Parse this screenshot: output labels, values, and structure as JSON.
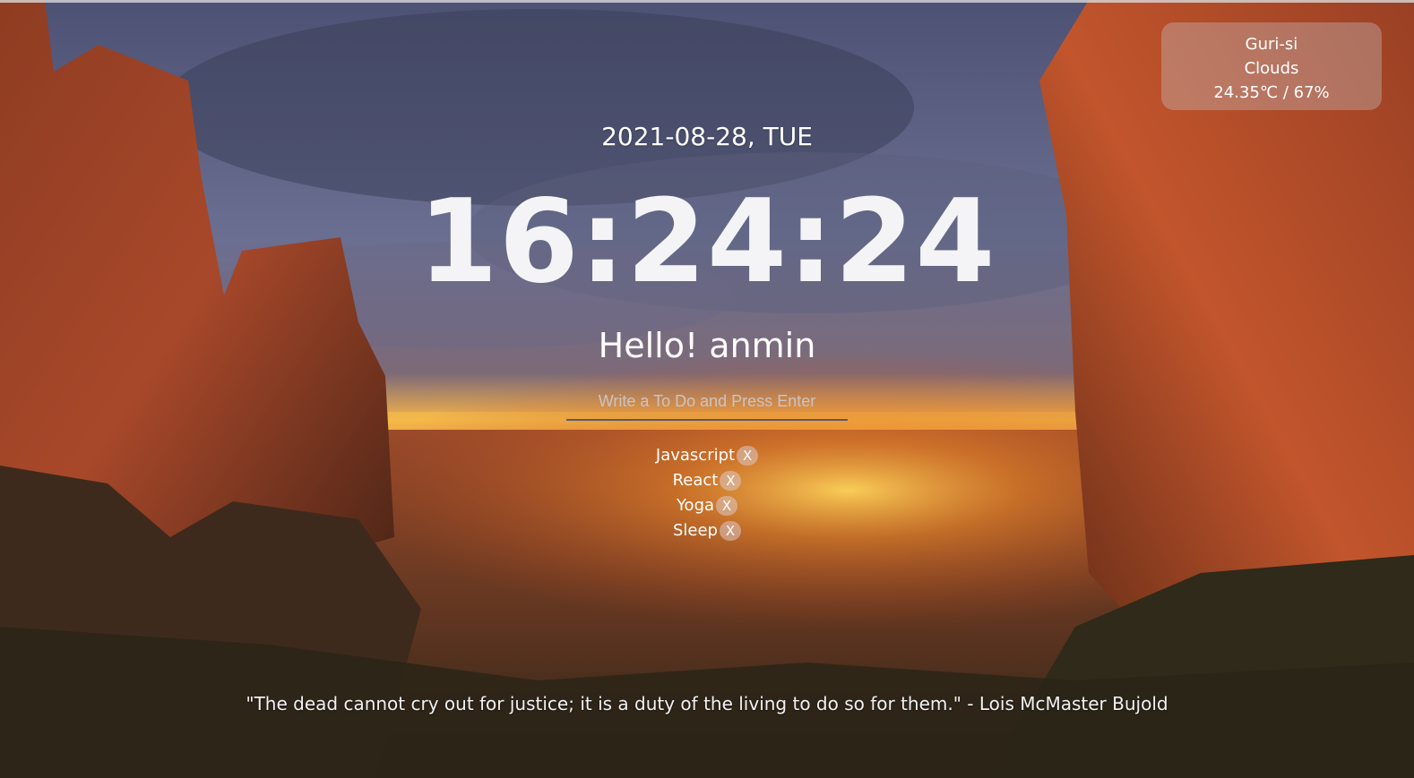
{
  "weather": {
    "city": "Guri-si",
    "condition": "Clouds",
    "temp_humidity": "24.35℃ / 67%"
  },
  "date": "2021-08-28, TUE",
  "clock": "16:24:24",
  "greeting": "Hello! anmin",
  "todo_input": {
    "placeholder": "Write a To Do and Press Enter",
    "value": ""
  },
  "todos": [
    {
      "text": "Javascript",
      "delete_label": "X"
    },
    {
      "text": "React",
      "delete_label": "X"
    },
    {
      "text": "Yoga",
      "delete_label": "X"
    },
    {
      "text": "Sleep",
      "delete_label": "X"
    }
  ],
  "quote": "\"The dead cannot cry out for justice; it is a duty of the living to do so for them.\" - Lois McMaster Bujold"
}
